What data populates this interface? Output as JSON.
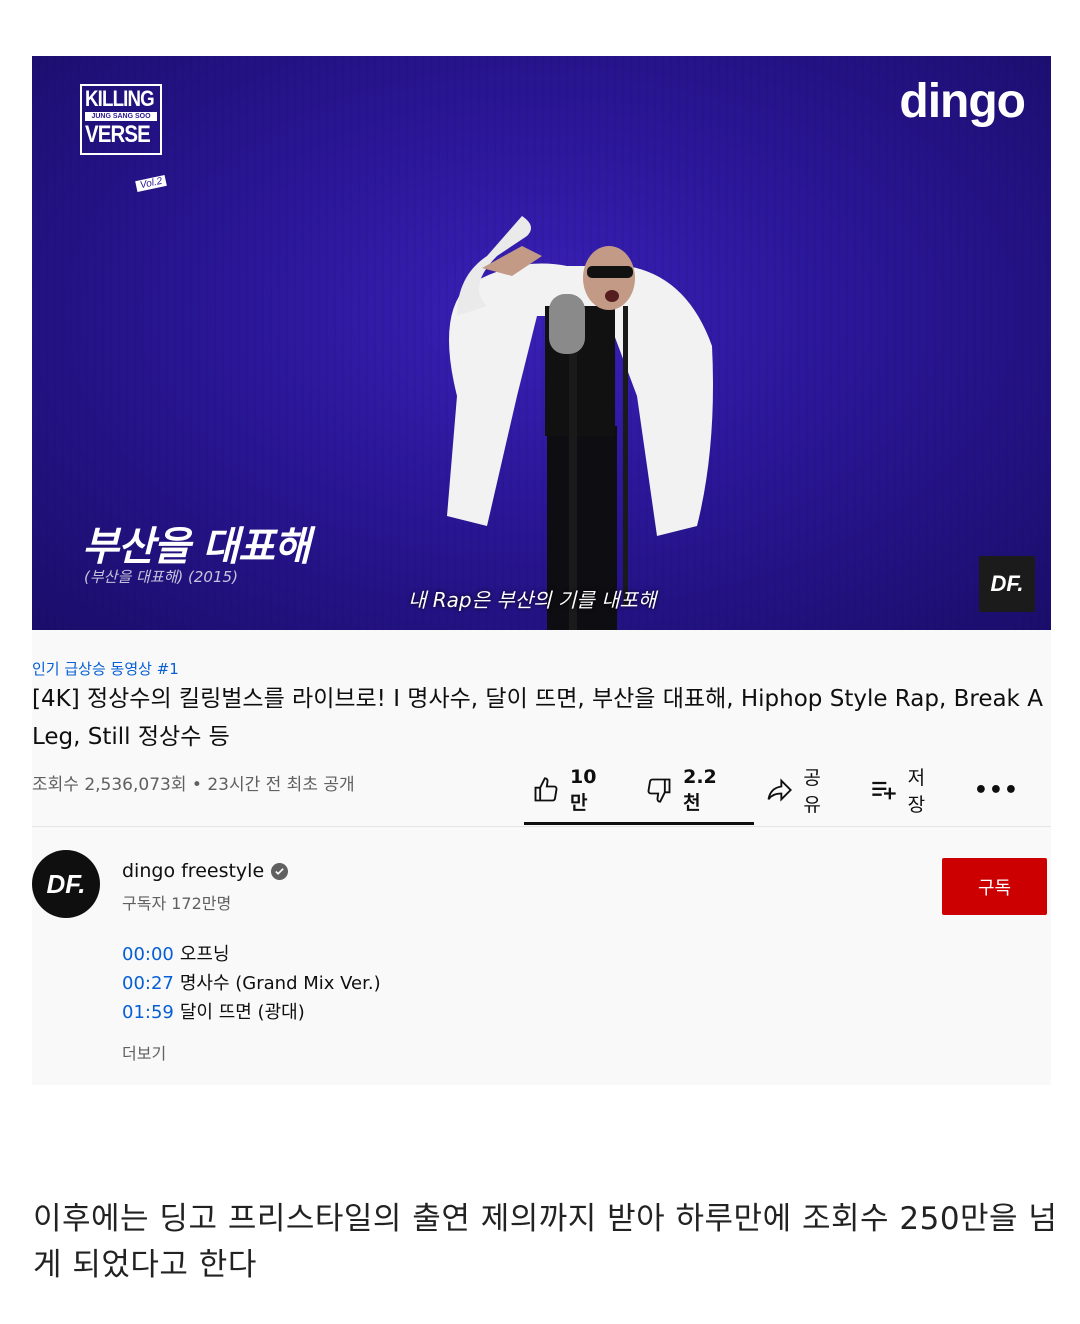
{
  "video": {
    "series_logo": {
      "line1": "KILLING",
      "line2": "JUNG SANG SOO",
      "line3": "VERSE",
      "line4": "Vol.2"
    },
    "brand_logo": "dingo",
    "song_title": "부산을 대표해",
    "song_subtitle": "(부산을 대표해) (2015)",
    "caption": "내 Rap은 부산의 기를 내포해",
    "corner_badge": "DF."
  },
  "details": {
    "trending": "인기 급상승 동영상 #1",
    "title": "[4K] 정상수의 킬링벌스를 라이브로! I 명사수, 달이 뜨면, 부산을 대표해, Hiphop Style Rap, Break A Leg, Still 정상수 등",
    "meta": "조회수 2,536,073회 • 23시간 전 최초 공개",
    "actions": {
      "like_count": "10만",
      "dislike_count": "2.2천",
      "share_label": "공유",
      "save_label": "저장",
      "more_label": "•••"
    }
  },
  "channel": {
    "avatar_text": "DF.",
    "name": "dingo freestyle",
    "subscribers": "구독자 172만명",
    "subscribe_label": "구독"
  },
  "chapters": [
    {
      "time": "00:00",
      "label": "오프닝"
    },
    {
      "time": "00:27",
      "label": "명사수 (Grand Mix Ver.)"
    },
    {
      "time": "01:59",
      "label": "달이 뜨면 (광대)"
    }
  ],
  "more_label": "더보기",
  "body_text": "이후에는 딩고 프리스타일의 출연 제의까지 받아 하루만에 조회수 250만을 넘게 되었다고 한다",
  "colors": {
    "link": "#065fd4",
    "subscribe": "#cc0000",
    "video_bg": "#2a1696"
  }
}
